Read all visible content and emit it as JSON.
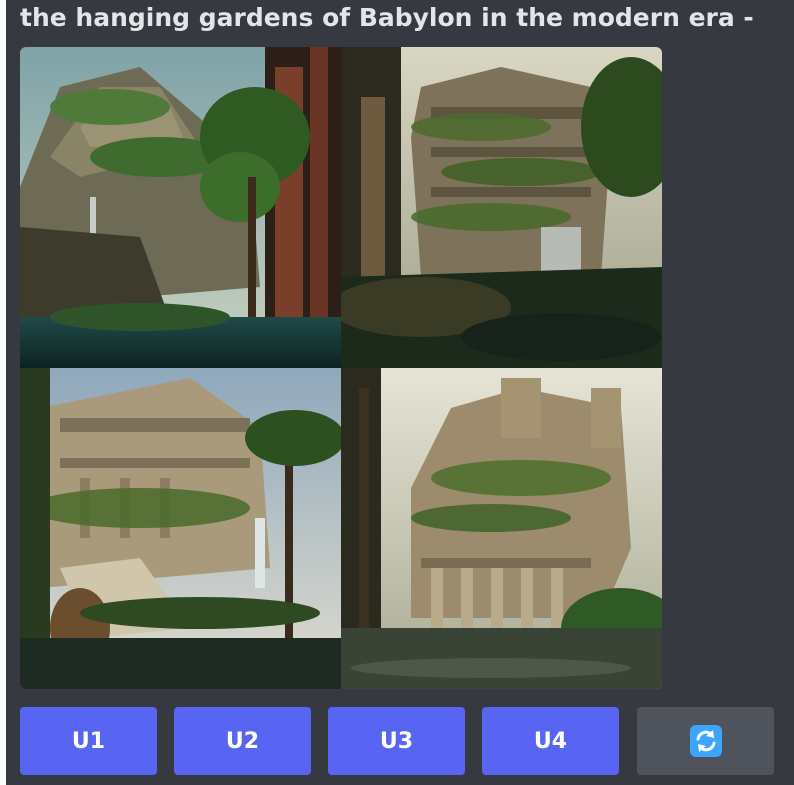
{
  "message": {
    "prompt_text": "the hanging gardens of Babylon in the modern era -"
  },
  "image_grid": {
    "tiles": [
      {
        "subject": "terraced ziggurat with waterfall and trees"
      },
      {
        "subject": "vine-covered building with waterfall"
      },
      {
        "subject": "palace terraces with palm trees and statue"
      },
      {
        "subject": "colonnaded tower overgrown with plants above water"
      }
    ]
  },
  "buttons": {
    "u1_label": "U1",
    "u2_label": "U2",
    "u3_label": "U3",
    "u4_label": "U4",
    "reroll_icon": "refresh-icon"
  },
  "colors": {
    "background": "#36393f",
    "accent": "#5865f2",
    "secondary": "#4f545c",
    "refresh_icon": "#3ba5ff",
    "text": "#e3e5e8"
  }
}
